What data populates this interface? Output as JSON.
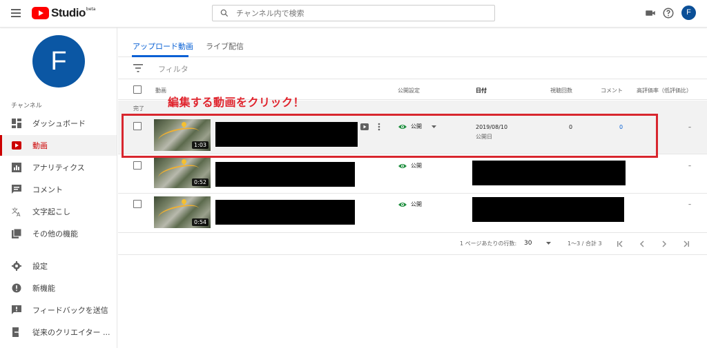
{
  "header": {
    "logo_text": "Studio",
    "logo_beta": "beta",
    "search_placeholder": "チャンネル内で検索",
    "avatar_letter": "F"
  },
  "sidebar": {
    "avatar_letter": "F",
    "channel_label": "チャンネル",
    "items": [
      {
        "label": "ダッシュボード",
        "icon": "dashboard-icon"
      },
      {
        "label": "動画",
        "icon": "video-icon",
        "active": true
      },
      {
        "label": "アナリティクス",
        "icon": "analytics-icon"
      },
      {
        "label": "コメント",
        "icon": "comment-icon"
      },
      {
        "label": "文字起こし",
        "icon": "translate-icon"
      },
      {
        "label": "その他の機能",
        "icon": "more-features-icon"
      }
    ],
    "bottom_items": [
      {
        "label": "設定",
        "icon": "settings-icon"
      },
      {
        "label": "新機能",
        "icon": "whats-new-icon"
      },
      {
        "label": "フィードバックを送信",
        "icon": "feedback-icon"
      },
      {
        "label": "従来のクリエイター ...",
        "icon": "classic-studio-icon"
      }
    ]
  },
  "main": {
    "tabs": [
      {
        "label": "アップロード動画",
        "active": true
      },
      {
        "label": "ライブ配信"
      }
    ],
    "filter_label": "フィルタ",
    "columns": {
      "video": "動画",
      "visibility": "公開設定",
      "date": "日付",
      "views": "視聴回数",
      "comments": "コメント",
      "rating": "高評価率（低評価比）"
    },
    "section_label": "完了",
    "rows": [
      {
        "duration": "1:03",
        "visibility": "公開",
        "date": "2019/08/10",
        "date_sub": "公開日",
        "views": "0",
        "comments": "0",
        "rating": "–"
      },
      {
        "duration": "0:52",
        "visibility": "公開",
        "rating": "–"
      },
      {
        "duration": "0:54",
        "visibility": "公開",
        "rating": "–"
      }
    ],
    "callout": "編集する動画をクリック！",
    "pager": {
      "rows_per_page_label": "1 ページあたりの行数:",
      "rows_per_page": "30",
      "range": "1〜3 / 合計 3"
    }
  },
  "colors": {
    "brand_red": "#ff0000",
    "accent_blue": "#065fd4",
    "callout_red": "#e0242d",
    "public_green": "#1e8e3e",
    "avatar_blue": "#0b57a4"
  }
}
